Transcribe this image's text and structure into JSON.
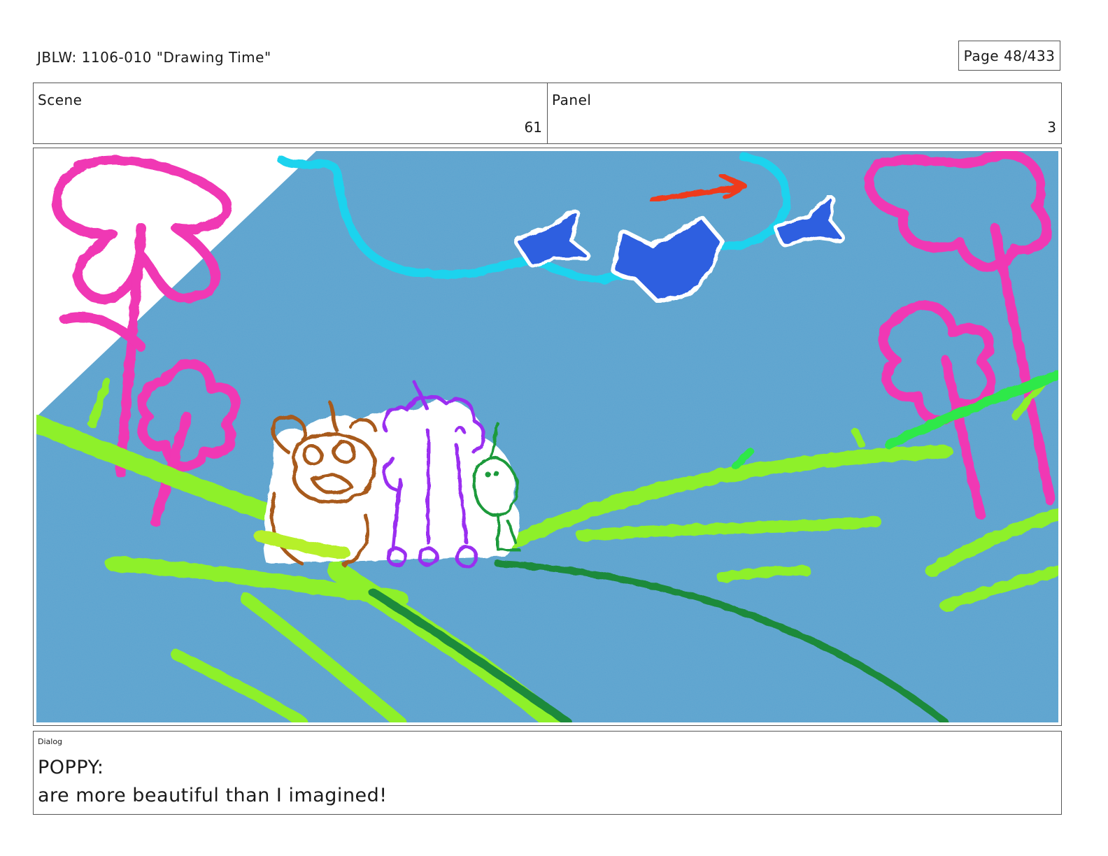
{
  "header": {
    "title": "JBLW: 1106-010 \"Drawing Time\"",
    "page_label": "Page",
    "page_value": "48/433"
  },
  "info": {
    "scene_label": "Scene",
    "scene_value": "61",
    "panel_label": "Panel",
    "panel_value": "3"
  },
  "dialog": {
    "label": "Dialog",
    "speaker": "POPPY:",
    "line": "are more beautiful than I imagined!"
  },
  "colors": {
    "sky": "#5aa3d0",
    "flower_pink": "#f037b4",
    "grass_lime": "#8ef02a",
    "grass_dark": "#1e8a3a",
    "cloud_cyan": "#1fd3ee",
    "crane_blue": "#2f5fe0",
    "arrow_red": "#ee3a1e",
    "bear_brown": "#a85a1a",
    "unicorn_purple": "#9a2ff0",
    "sprout_green": "#1f9a3a"
  }
}
